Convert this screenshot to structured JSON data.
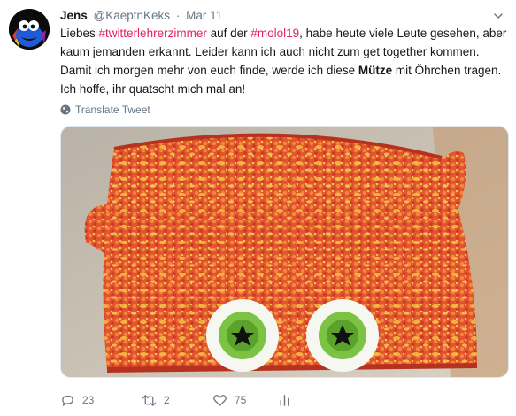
{
  "tweet": {
    "author_name": "Jens",
    "author_handle": "@KaeptnKeks",
    "separator": "·",
    "date": "Mar 11",
    "text": {
      "part1": "Liebes ",
      "hashtag1": "#twitterlehrerzimmer",
      "part2": " auf der ",
      "hashtag2": "#molol19",
      "part3": ", habe heute viele Leute gesehen, aber kaum jemanden erkannt. Leider kann ich auch nicht zum get together kommen. Damit ich morgen mehr von euch finde, werde ich diese ",
      "bold": "Mütze",
      "part4": " mit Öhrchen tragen. Ich hoffe, ihr quatscht mich mal an!"
    },
    "translate_label": "Translate Tweet",
    "actions": {
      "reply_count": "23",
      "retweet_count": "2",
      "like_count": "75"
    }
  },
  "colors": {
    "hashtag": "#e0245e",
    "secondary_text": "#657786",
    "primary_text": "#14171a"
  },
  "icons": [
    "avatar-image",
    "chevron-down-icon",
    "globe-icon",
    "reply-icon",
    "retweet-icon",
    "like-icon",
    "analytics-icon"
  ]
}
